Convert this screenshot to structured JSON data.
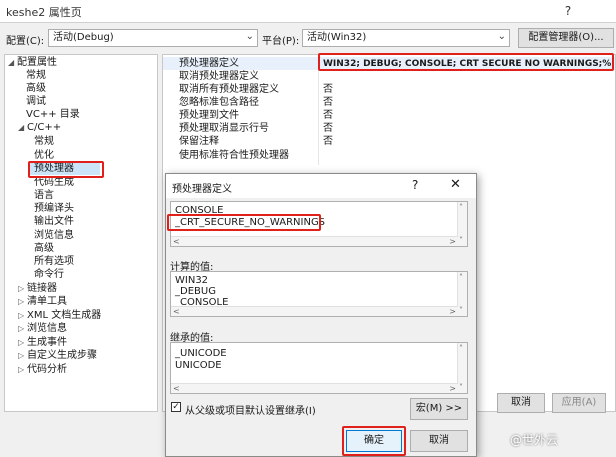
{
  "window": {
    "title": "keshe2 属性页",
    "help": "?"
  },
  "config": {
    "label": "配置(C):",
    "value": "活动(Debug)",
    "platform_label": "平台(P):",
    "platform_value": "活动(Win32)",
    "manager_button": "配置管理器(O)..."
  },
  "tree": {
    "items": [
      {
        "label": "配置属性",
        "arrow": "◢"
      },
      {
        "label": "常规"
      },
      {
        "label": "高级"
      },
      {
        "label": "调试"
      },
      {
        "label": "VC++ 目录"
      },
      {
        "label": "C/C++",
        "arrow": "◢"
      },
      {
        "label": "常规"
      },
      {
        "label": "优化"
      },
      {
        "label": "预处理器"
      },
      {
        "label": "代码生成"
      },
      {
        "label": "语言"
      },
      {
        "label": "预编译头"
      },
      {
        "label": "输出文件"
      },
      {
        "label": "浏览信息"
      },
      {
        "label": "高级"
      },
      {
        "label": "所有选项"
      },
      {
        "label": "命令行"
      },
      {
        "label": "链接器",
        "arrow": "▷"
      },
      {
        "label": "清单工具",
        "arrow": "▷"
      },
      {
        "label": "XML 文档生成器",
        "arrow": "▷"
      },
      {
        "label": "浏览信息",
        "arrow": "▷"
      },
      {
        "label": "生成事件",
        "arrow": "▷"
      },
      {
        "label": "自定义生成步骤",
        "arrow": "▷"
      },
      {
        "label": "代码分析",
        "arrow": "▷"
      }
    ]
  },
  "properties": [
    {
      "name": "预处理器定义",
      "value": "WIN32; DEBUG; CONSOLE; CRT SECURE NO WARNINGS;%"
    },
    {
      "name": "取消预处理器定义",
      "value": ""
    },
    {
      "name": "取消所有预处理器定义",
      "value": "否"
    },
    {
      "name": "忽略标准包含路径",
      "value": "否"
    },
    {
      "name": "预处理到文件",
      "value": "否"
    },
    {
      "name": "预处理取消显示行号",
      "value": "否"
    },
    {
      "name": "保留注释",
      "value": "否"
    },
    {
      "name": "使用标准符合性预处理器",
      "value": ""
    }
  ],
  "buttons": {
    "cancel": "取消",
    "apply": "应用(A)"
  },
  "dialog": {
    "title": "预处理器定义",
    "help": "?",
    "close": "✕",
    "edit_lines": [
      "CONSOLE",
      "_CRT_SECURE_NO_WARNINGS"
    ],
    "computed_label": "计算的值:",
    "computed_lines": [
      "WIN32",
      "_DEBUG",
      "_CONSOLE"
    ],
    "inherited_label": "继承的值:",
    "inherited_lines": [
      "_UNICODE",
      "UNICODE"
    ],
    "inherit_checkbox_label": "从父级或项目默认设置继承(I)",
    "inherit_checked": true,
    "macro_button": "宏(M) >>",
    "ok_button": "确定",
    "cancel_button": "取消"
  },
  "watermark": "@世外云",
  "colors": {
    "highlight": "#e0201b",
    "selection": "#cce4f7",
    "ok_border": "#0078d7"
  }
}
